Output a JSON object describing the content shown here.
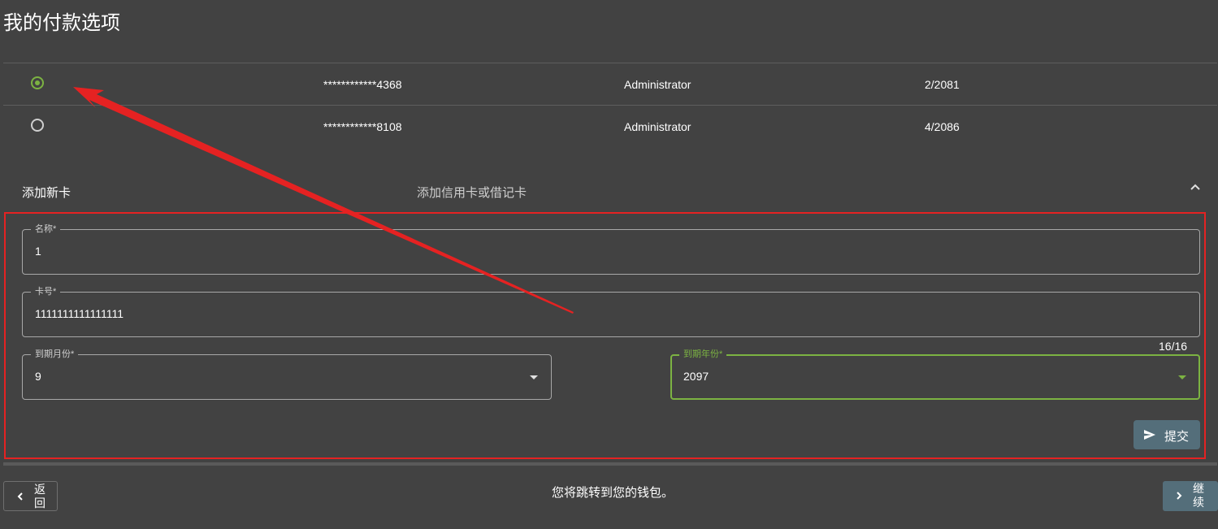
{
  "page": {
    "title": "我的付款选项"
  },
  "cards": [
    {
      "selected": true,
      "number": "************4368",
      "owner": "Administrator",
      "expiry": "2/2081"
    },
    {
      "selected": false,
      "number": "************8108",
      "owner": "Administrator",
      "expiry": "4/2086"
    }
  ],
  "add_card": {
    "title": "添加新卡",
    "description": "添加信用卡或借记卡",
    "expanded_icon": "chevron-up-icon",
    "form": {
      "name": {
        "label": "名称*",
        "value": "1"
      },
      "card_number": {
        "label": "卡号*",
        "value": "1111111111111111",
        "counter": "16/16"
      },
      "exp_month": {
        "label": "到期月份*",
        "value": "9"
      },
      "exp_year": {
        "label": "到期年份*",
        "value": "2097"
      },
      "submit": {
        "label": "提交",
        "icon": "send-icon"
      }
    }
  },
  "footer": {
    "back_label": "返回",
    "message": "您将跳转到您的钱包。",
    "continue_label": "继续"
  },
  "colors": {
    "background": "#424242",
    "accent_green": "#7cb342",
    "button_bluegray": "#546e7a",
    "annotation_red": "#e52222"
  }
}
